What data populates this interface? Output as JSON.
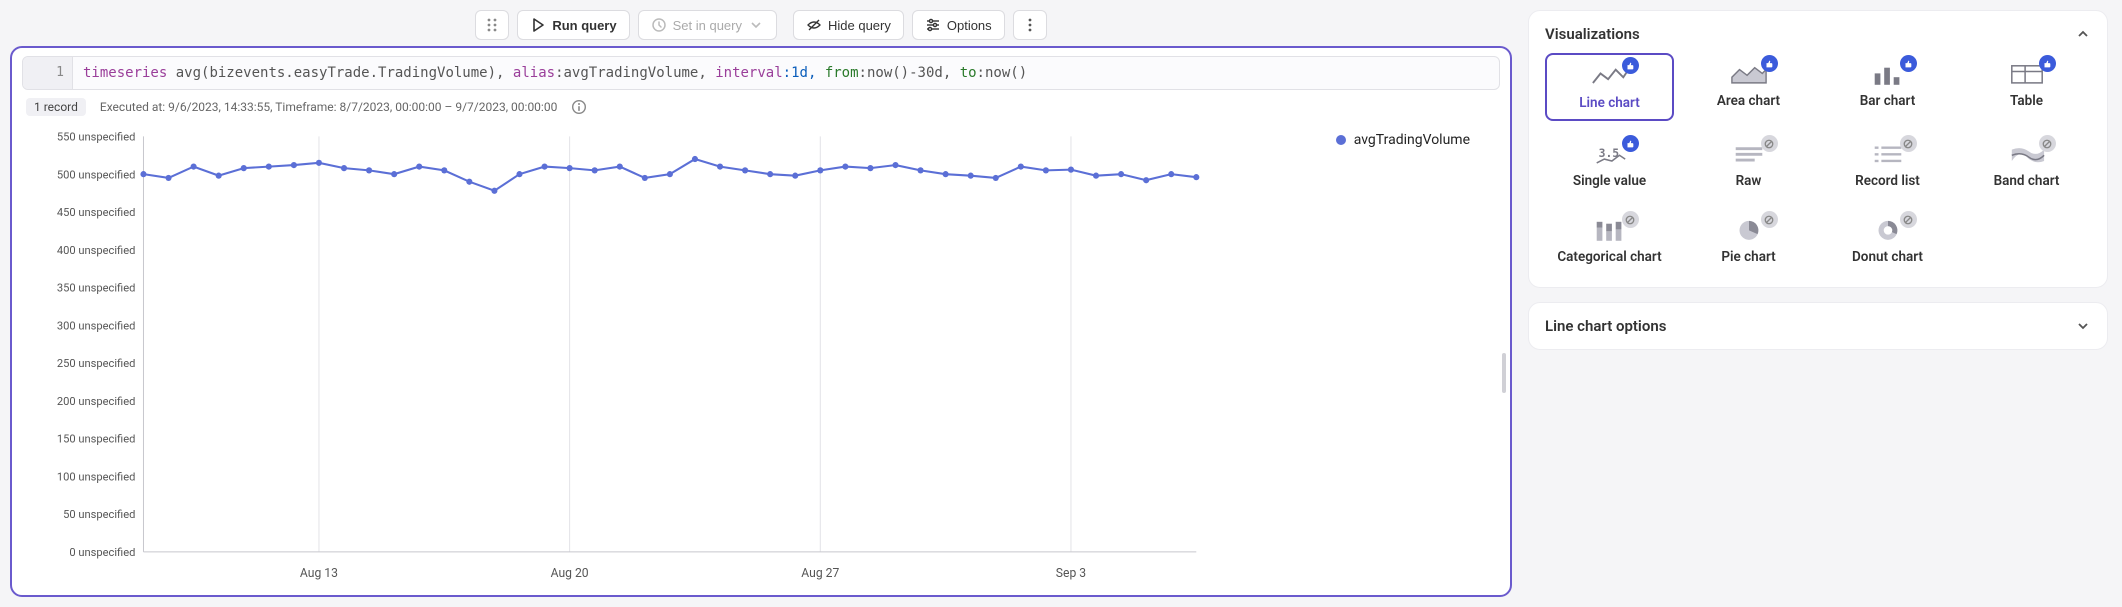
{
  "toolbar": {
    "run_label": "Run query",
    "set_in_query_label": "Set in query",
    "hide_label": "Hide query",
    "options_label": "Options"
  },
  "query": {
    "line_number": "1",
    "tokens": {
      "cmd": "timeseries",
      "agg": "avg(bizevents.easyTrade.TradingVolume),",
      "alias_k": "alias",
      "alias_v": ":avgTradingVolume,",
      "interval_k": "interval",
      "interval_v": ":1d,",
      "from_k": "from",
      "from_v": ":now()-30d,",
      "to_k": "to",
      "to_v": ":now()"
    }
  },
  "status": {
    "records": "1 record",
    "executed": "Executed at: 9/6/2023, 14:33:55, Timeframe: 8/7/2023, 00:00:00 – 9/7/2023, 00:00:00"
  },
  "chart_data": {
    "type": "line",
    "series_name": "avgTradingVolume",
    "series_color": "#5b6fd6",
    "y_ticks": [
      0,
      50,
      100,
      150,
      200,
      250,
      300,
      350,
      400,
      450,
      500,
      550
    ],
    "y_unit": "unspecified",
    "ylim": [
      0,
      550
    ],
    "x_ticks": [
      "Aug 13",
      "Aug 20",
      "Aug 27",
      "Sep 3"
    ],
    "values": [
      500,
      495,
      510,
      498,
      508,
      510,
      512,
      515,
      508,
      505,
      500,
      510,
      505,
      490,
      478,
      500,
      510,
      508,
      505,
      510,
      495,
      500,
      520,
      510,
      505,
      500,
      498,
      505,
      510,
      508,
      512,
      505,
      500,
      498,
      495,
      510,
      505,
      506,
      498,
      500,
      492,
      500,
      496
    ]
  },
  "visualizations": {
    "title": "Visualizations",
    "items": [
      {
        "label": "Line chart",
        "selected": true,
        "recommended": true,
        "iconKey": "line"
      },
      {
        "label": "Area chart",
        "selected": false,
        "recommended": true,
        "iconKey": "area"
      },
      {
        "label": "Bar chart",
        "selected": false,
        "recommended": true,
        "iconKey": "bar"
      },
      {
        "label": "Table",
        "selected": false,
        "recommended": true,
        "iconKey": "table"
      },
      {
        "label": "Single value",
        "selected": false,
        "recommended": true,
        "iconKey": "single"
      },
      {
        "label": "Raw",
        "selected": false,
        "recommended": false,
        "iconKey": "raw"
      },
      {
        "label": "Record list",
        "selected": false,
        "recommended": false,
        "iconKey": "reclist"
      },
      {
        "label": "Band chart",
        "selected": false,
        "recommended": false,
        "iconKey": "band"
      },
      {
        "label": "Categorical chart",
        "selected": false,
        "recommended": false,
        "iconKey": "cat"
      },
      {
        "label": "Pie chart",
        "selected": false,
        "recommended": false,
        "iconKey": "pie"
      },
      {
        "label": "Donut chart",
        "selected": false,
        "recommended": false,
        "iconKey": "donut"
      }
    ]
  },
  "options_panel": {
    "title": "Line chart options"
  }
}
